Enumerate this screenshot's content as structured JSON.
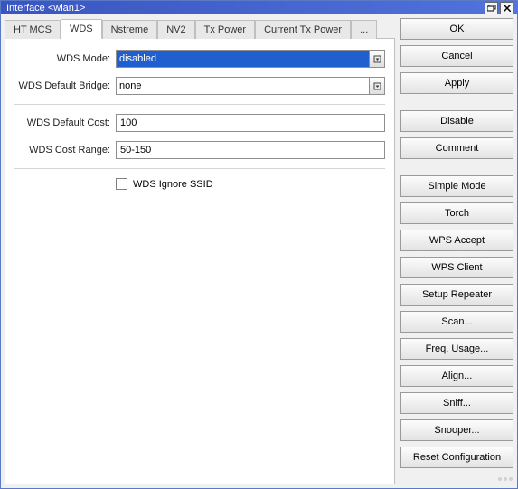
{
  "window": {
    "title": "Interface <wlan1>"
  },
  "tabs": {
    "ht_mcs": "HT MCS",
    "wds": "WDS",
    "nstreme": "Nstreme",
    "nv2": "NV2",
    "tx_power": "Tx Power",
    "current_tx_power": "Current Tx Power",
    "overflow": "..."
  },
  "fields": {
    "wds_mode": {
      "label": "WDS Mode:",
      "value": "disabled"
    },
    "wds_default_bridge": {
      "label": "WDS Default Bridge:",
      "value": "none"
    },
    "wds_default_cost": {
      "label": "WDS Default Cost:",
      "value": "100"
    },
    "wds_cost_range": {
      "label": "WDS Cost Range:",
      "value": "50-150"
    },
    "wds_ignore_ssid": {
      "label": "WDS Ignore SSID",
      "checked": false
    }
  },
  "buttons": {
    "ok": "OK",
    "cancel": "Cancel",
    "apply": "Apply",
    "disable": "Disable",
    "comment": "Comment",
    "simple_mode": "Simple Mode",
    "torch": "Torch",
    "wps_accept": "WPS Accept",
    "wps_client": "WPS Client",
    "setup_repeater": "Setup Repeater",
    "scan": "Scan...",
    "freq_usage": "Freq. Usage...",
    "align": "Align...",
    "sniff": "Sniff...",
    "snooper": "Snooper...",
    "reset_configuration": "Reset Configuration"
  }
}
